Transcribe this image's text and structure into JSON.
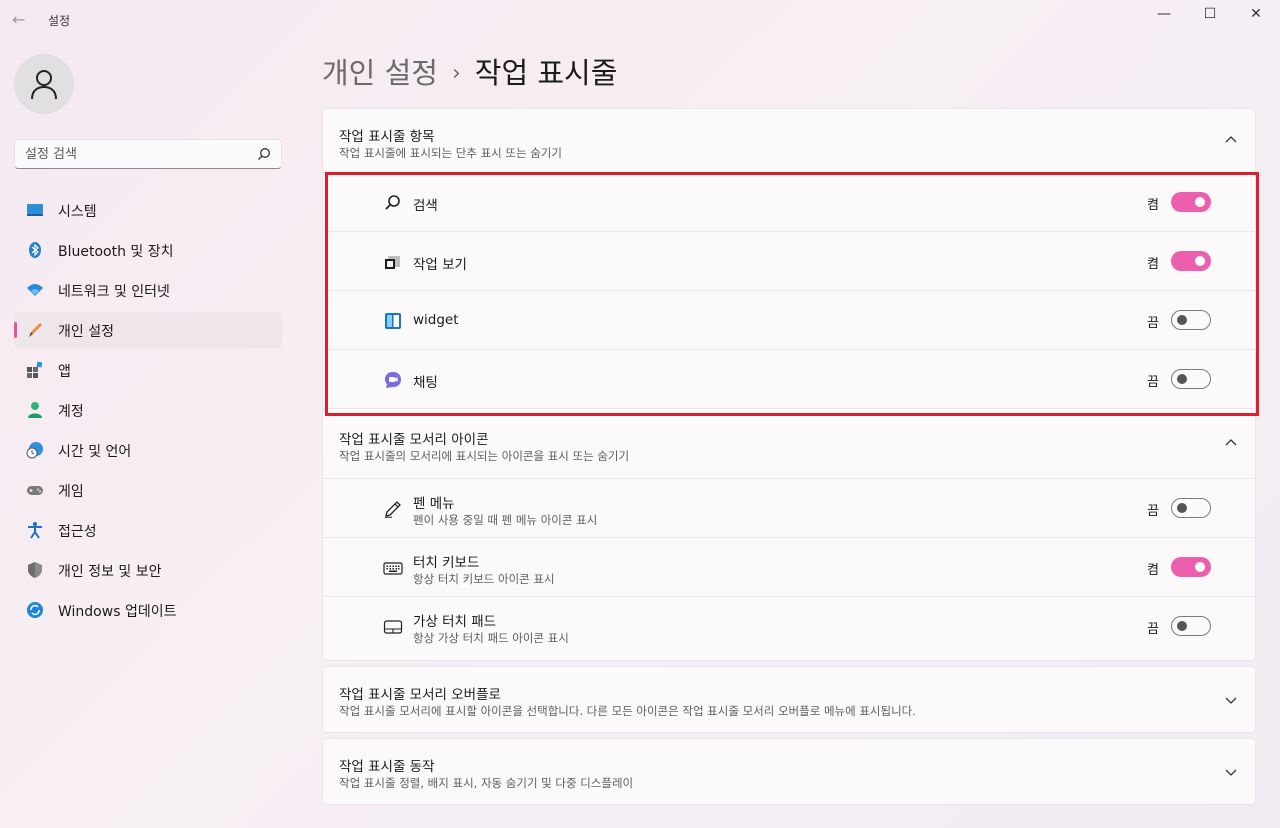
{
  "window": {
    "title": "설정",
    "back_glyph": "←",
    "min_glyph": "—",
    "max_glyph": "☐",
    "close_glyph": "✕"
  },
  "sidebar": {
    "search_placeholder": "설정 검색",
    "items": [
      {
        "label": "시스템",
        "icon": "system-icon"
      },
      {
        "label": "Bluetooth 및 장치",
        "icon": "bluetooth-icon"
      },
      {
        "label": "네트워크 및 인터넷",
        "icon": "network-icon"
      },
      {
        "label": "개인 설정",
        "icon": "personalization-icon",
        "selected": true
      },
      {
        "label": "앱",
        "icon": "apps-icon"
      },
      {
        "label": "계정",
        "icon": "accounts-icon"
      },
      {
        "label": "시간 및 언어",
        "icon": "time-language-icon"
      },
      {
        "label": "게임",
        "icon": "gaming-icon"
      },
      {
        "label": "접근성",
        "icon": "accessibility-icon"
      },
      {
        "label": "개인 정보 및 보안",
        "icon": "privacy-icon"
      },
      {
        "label": "Windows 업데이트",
        "icon": "windows-update-icon"
      }
    ],
    "accent": "#e3549f"
  },
  "breadcrumb": {
    "parent": "개인 설정",
    "separator": "›",
    "current": "작업 표시줄"
  },
  "sections": {
    "taskbar_items": {
      "title": "작업 표시줄 항목",
      "subtitle": "작업 표시줄에 표시되는 단추 표시 또는 숨기기",
      "expanded": true,
      "rows": [
        {
          "label": "검색",
          "icon": "search-icon",
          "state": "켬",
          "on": true
        },
        {
          "label": "작업 보기",
          "icon": "task-view-icon",
          "state": "켬",
          "on": true
        },
        {
          "label": "widget",
          "icon": "widgets-icon",
          "state": "끔",
          "on": false
        },
        {
          "label": "채팅",
          "icon": "chat-icon",
          "state": "끔",
          "on": false
        }
      ]
    },
    "corner_icons": {
      "title": "작업 표시줄 모서리 아이콘",
      "subtitle": "작업 표시줄의 모서리에 표시되는 아이콘을 표시 또는 숨기기",
      "expanded": true,
      "rows": [
        {
          "label": "펜 메뉴",
          "sub": "펜이 사용 중일 때 펜 메뉴 아이콘 표시",
          "icon": "pen-icon",
          "state": "끔",
          "on": false
        },
        {
          "label": "터치 키보드",
          "sub": "항상 터치 키보드 아이콘 표시",
          "icon": "keyboard-icon",
          "state": "켬",
          "on": true
        },
        {
          "label": "가상 터치 패드",
          "sub": "항상 가상 터치 패드 아이콘 표시",
          "icon": "touchpad-icon",
          "state": "끔",
          "on": false
        }
      ]
    },
    "corner_overflow": {
      "title": "작업 표시줄 모서리 오버플로",
      "subtitle": "작업 표시줄 모서리에 표시할 아이콘을 선택합니다. 다른 모든 아이콘은 작업 표시줄 모서리 오버플로 메뉴에 표시됩니다.",
      "expanded": false
    },
    "behaviors": {
      "title": "작업 표시줄 동작",
      "subtitle": "작업 표시줄 정렬, 배지 표시, 자동 숨기기 및 다중 디스플레이",
      "expanded": false
    }
  },
  "colors": {
    "toggle_on": "#ec5fae",
    "highlight_box": "#dc1f2c"
  }
}
